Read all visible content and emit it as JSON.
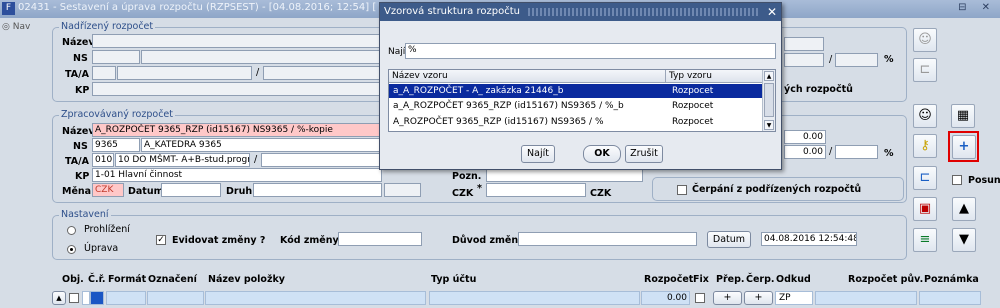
{
  "window": {
    "title": "02431 - Sestavení a úprava rozpočtu (RZPSEST) - [04.08.2016; 12:54] [ ] [ ]",
    "controls": "⊟ ✕"
  },
  "nav": {
    "label": "Nav"
  },
  "nadrizeny": {
    "group_title": "Nadřízený rozpočet",
    "nazev_label": "Název",
    "ns_label": "NS",
    "taa_label": "TA/A",
    "kp_label": "KP",
    "slash": "/",
    "pct": "%"
  },
  "zpracovavany": {
    "group_title": "Zpracovávaný rozpočet",
    "nazev_label": "Název",
    "nazev_value": "A_ROZPOČET 9365_RZP (id15167) NS9365 / %-kopie",
    "ns_label": "NS",
    "ns_code": "9365",
    "ns_name": "A_KATEDRA 9365",
    "taa_label": "TA/A",
    "taa_code": "010",
    "taa_name": "10 DO MŠMT- A+B-stud.progr.",
    "slash": "/",
    "kp_label": "KP",
    "kp_value": "1-01 Hlavní činnost",
    "mena_label": "Měna",
    "mena_value": "CZK",
    "datum_label": "Datum",
    "druh_label": "Druh",
    "pozn_label": "Pozn.",
    "czk1": "CZK",
    "star": "*",
    "czk2": "CZK",
    "amount1": "0.00",
    "amount2": "0.00",
    "pct": "%",
    "cerpani_label": "Čerpání z podřízených rozpočtů",
    "right_partial": "ých rozpočtů"
  },
  "nastaveni": {
    "group_title": "Nastavení",
    "prohlizeni": "Prohlížení",
    "uprava": "Úprava",
    "evidovat": "Evidovat změny ?",
    "kod_label": "Kód změny",
    "duvod_label": "Důvod změny",
    "datum_btn": "Datum",
    "datum_value": "04.08.2016 12:54:48"
  },
  "posun": "Posun",
  "grid": {
    "headers": [
      "Obj.",
      "Č.ř.",
      "Formát",
      "Označení",
      "Název položky",
      "Typ účtu",
      "Rozpočet",
      "Fix",
      "Přep.",
      "Čerp.",
      "Odkud",
      "Rozpočet pův.",
      "Poznámka"
    ],
    "row_rozpocet": "0.00",
    "plus1": "+",
    "plus2": "+",
    "odkud": "ZP"
  },
  "dialog": {
    "title": "Vzorová struktura rozpočtu",
    "najit_label": "Najít",
    "najit_value": "%",
    "col_nazev": "Název vzoru",
    "col_typ": "Typ vzoru",
    "rows": [
      {
        "nazev": "a_A_ROZPOČET - A_ zakázka 21446_b",
        "typ": "Rozpocet"
      },
      {
        "nazev": "a_A_ROZPOČET 9365_RZP (id15167) NS9365 / %_b",
        "typ": "Rozpocet"
      },
      {
        "nazev": "A_ROZPOČET 9365_RZP (id15167) NS9365 / %",
        "typ": "Rozpocet"
      }
    ],
    "btn_najit": "Najít",
    "btn_ok": "OK",
    "btn_zrusit": "Zrušit"
  }
}
